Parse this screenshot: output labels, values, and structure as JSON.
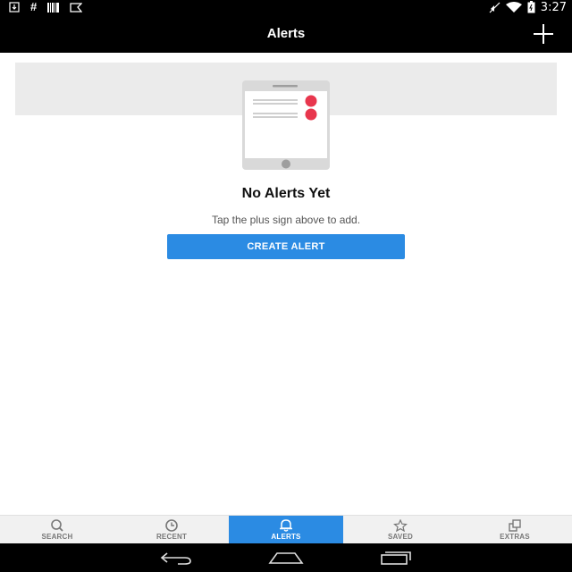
{
  "status_bar": {
    "time": "3:27",
    "left_icons": [
      "download-icon",
      "hash-icon",
      "barcode-icon",
      "flipboard-icon"
    ],
    "hash_glyph": "#",
    "right_icons": [
      "mute-icon",
      "wifi-icon",
      "battery-icon"
    ]
  },
  "app_bar": {
    "title": "Alerts",
    "action_icon": "plus-icon"
  },
  "empty_state": {
    "title": "No Alerts Yet",
    "subtitle": "Tap the plus sign above to add.",
    "button_label": "CREATE ALERT"
  },
  "bottom_nav": {
    "items": [
      {
        "label": "SEARCH",
        "icon": "search-icon",
        "active": false
      },
      {
        "label": "RECENT",
        "icon": "clock-icon",
        "active": false
      },
      {
        "label": "ALERTS",
        "icon": "bell-icon",
        "active": true
      },
      {
        "label": "SAVED",
        "icon": "star-icon",
        "active": false
      },
      {
        "label": "EXTRAS",
        "icon": "extras-icon",
        "active": false
      }
    ]
  },
  "colors": {
    "accent": "#2b8be3",
    "app_bar": "#000000",
    "alert_dot": "#e8364d",
    "banner": "#ebebeb"
  }
}
